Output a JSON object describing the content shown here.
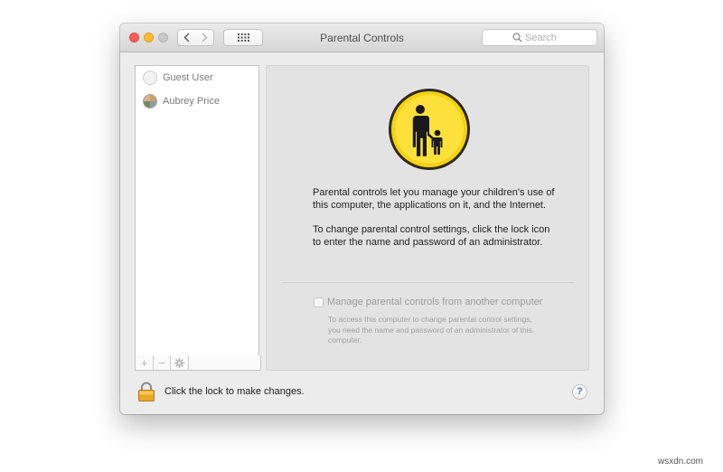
{
  "window": {
    "title": "Parental Controls",
    "search_placeholder": "Search"
  },
  "users": [
    {
      "name": "Guest User"
    },
    {
      "name": "Aubrey Price"
    }
  ],
  "list_toolbar": {
    "add": "+",
    "remove": "−",
    "action": "gear-icon"
  },
  "main": {
    "paragraph1": "Parental controls let you manage your children's use of this computer, the applications on it, and the Internet.",
    "paragraph2": "To change parental control settings, click the lock icon to enter the name and password of an administrator.",
    "manage_checkbox_label": "Manage parental controls from another computer",
    "manage_checkbox_checked": false,
    "manage_help": "To access this computer to change parental control settings, you need the name and password of an administrator of this computer."
  },
  "footer": {
    "lock_label": "Click the lock to make changes.",
    "help": "?"
  },
  "watermark": "wsxdn.com",
  "colors": {
    "icon_yellow": "#f5d20f",
    "close": "#fc5f57",
    "minimize": "#fdbc2e"
  }
}
